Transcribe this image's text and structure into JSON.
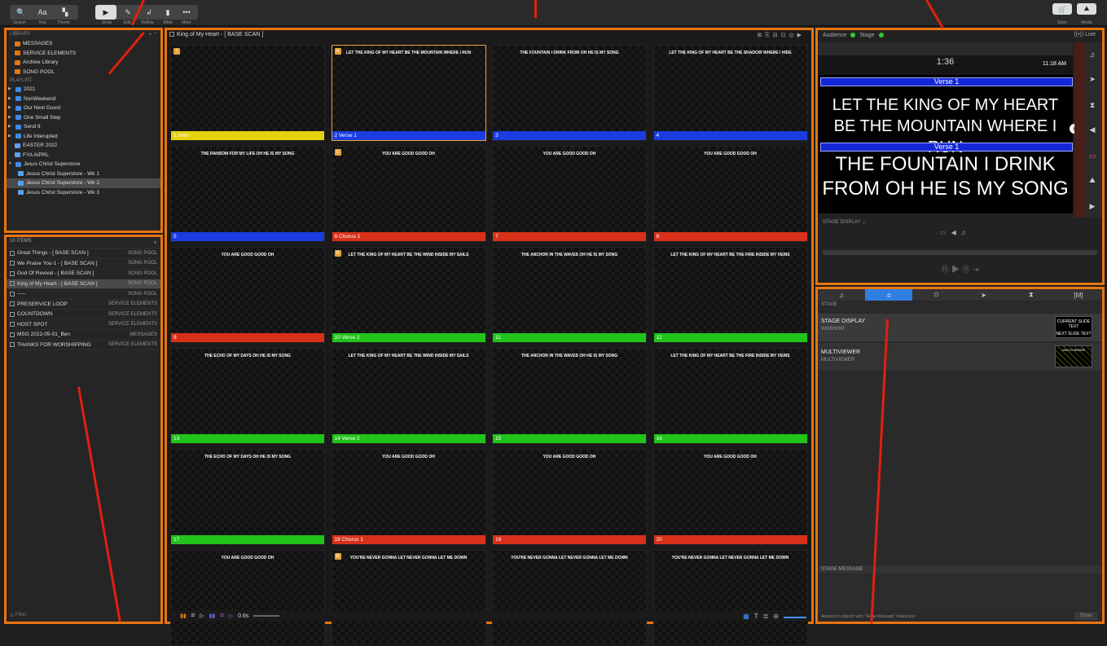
{
  "toolbar": {
    "left": [
      {
        "label": "Search",
        "icon": "search-icon"
      },
      {
        "label": "Text",
        "icon": "text-icon"
      },
      {
        "label": "Theme",
        "icon": "theme-icon"
      }
    ],
    "mode": [
      {
        "label": "Show",
        "icon": "play-icon"
      },
      {
        "label": "Edit",
        "icon": "pencil-icon"
      },
      {
        "label": "Reflow",
        "icon": "reflow-icon"
      },
      {
        "label": "Bible",
        "icon": "bible-icon"
      },
      {
        "label": "More",
        "icon": "more-icon"
      }
    ],
    "right": [
      {
        "label": "Store",
        "icon": "store-icon"
      },
      {
        "label": "Media",
        "icon": "media-icon"
      }
    ],
    "glyphs": {
      "search": "🔍",
      "text": "Aa",
      "theme": "▚",
      "show": "▶",
      "edit": "✎",
      "bible": "▮",
      "more": "•••",
      "store": "🛒",
      "media": "⛰"
    }
  },
  "library": {
    "header": "LIBRARY",
    "items": [
      "MESSAGES",
      "SERVICE ELEMENTS",
      "Archive Library",
      "SONG POOL"
    ],
    "playlist_header": "PLAYLIST",
    "playlists": [
      {
        "label": "2021",
        "type": "folder",
        "expanded": false
      },
      {
        "label": "NonWeekend",
        "type": "folder",
        "expanded": false
      },
      {
        "label": "Our Next Guest",
        "type": "folder",
        "expanded": false
      },
      {
        "label": "One Small Step",
        "type": "folder",
        "expanded": false
      },
      {
        "label": "Send It",
        "type": "folder",
        "expanded": false
      },
      {
        "label": "Life Interupted",
        "type": "folder",
        "expanded": false
      },
      {
        "label": "EASTER 2022",
        "type": "playlist"
      },
      {
        "label": "FYA AIPRL",
        "type": "playlist"
      },
      {
        "label": "Jesus Christ Superstore",
        "type": "folder",
        "expanded": true
      },
      {
        "label": "Jesus Christ Superstore - Wk 1",
        "type": "playlist",
        "child": true
      },
      {
        "label": "Jesus Christ Superstore - Wk 2",
        "type": "playlist",
        "child": true,
        "selected": true
      },
      {
        "label": "Jesus Christ Superstore - Wk 3",
        "type": "playlist",
        "child": true
      }
    ]
  },
  "playlist": {
    "count": "10 ITEMS",
    "add": "+",
    "items": [
      {
        "name": "Great Things - [ BASE SCAN ]",
        "tag": "SONG POOL"
      },
      {
        "name": "We Praise You-1 - [ BASE SCAN ]",
        "tag": "SONG POOL"
      },
      {
        "name": "God Of Revival - [ BASE SCAN ]",
        "tag": "SONG POOL"
      },
      {
        "name": "King of My Heart - [ BASE SCAN ]",
        "tag": "SONG POOL",
        "selected": true
      },
      {
        "name": "-----",
        "tag": "SONG POOL"
      },
      {
        "name": "PRESERVICE LOOP",
        "tag": "SERVICE ELEMENTS"
      },
      {
        "name": "COUNTDOWN",
        "tag": "SERVICE ELEMENTS"
      },
      {
        "name": "HOST SPOT",
        "tag": "SERVICE ELEMENTS"
      },
      {
        "name": "MSG 2022-05-01_Ben",
        "tag": "MESSAGES"
      },
      {
        "name": "THANKS FOR WORSHIPPING",
        "tag": "SERVICE ELEMENTS"
      }
    ],
    "filter_placeholder": "Filter"
  },
  "presentation": {
    "title": "King of My Heart - [ BASE SCAN ]",
    "slides": [
      {
        "num": "1",
        "label": "Intro",
        "text": "",
        "color": "#e6d20e",
        "badge": "I"
      },
      {
        "num": "2",
        "label": "Verse 1",
        "text": "LET THE KING OF MY HEART BE THE MOUNTAIN WHERE I RUN",
        "color": "#1a3ce0",
        "badge": "A",
        "selected": true
      },
      {
        "num": "3",
        "label": "",
        "text": "THE FOUNTAIN I DRINK FROM OH HE IS MY SONG",
        "color": "#1a3ce0"
      },
      {
        "num": "4",
        "label": "",
        "text": "LET THE KING OF MY HEART BE THE SHADOW WHERE I HIDE",
        "color": "#1a3ce0"
      },
      {
        "num": "5",
        "label": "",
        "text": "THE RANSOM FOR MY LIFE OH HE IS MY SONG",
        "color": "#1a3ce0"
      },
      {
        "num": "6",
        "label": "Chorus 1",
        "text": "YOU ARE GOOD GOOD OH",
        "color": "#d9301a",
        "badge": "C"
      },
      {
        "num": "7",
        "label": "",
        "text": "YOU ARE GOOD GOOD OH",
        "color": "#d9301a"
      },
      {
        "num": "8",
        "label": "",
        "text": "YOU ARE GOOD GOOD OH",
        "color": "#d9301a"
      },
      {
        "num": "9",
        "label": "",
        "text": "YOU ARE GOOD GOOD OH",
        "color": "#d9301a"
      },
      {
        "num": "10",
        "label": "Verse 2",
        "text": "LET THE KING OF MY HEART BE THE WIND INSIDE MY SAILS",
        "color": "#21c41a",
        "badge": "B"
      },
      {
        "num": "11",
        "label": "",
        "text": "THE ANCHOR IN THE WAVES OH HE IS MY SONG",
        "color": "#21c41a"
      },
      {
        "num": "12",
        "label": "",
        "text": "LET THE KING OF MY HEART BE THE FIRE INSIDE MY VEINS",
        "color": "#21c41a"
      },
      {
        "num": "13",
        "label": "",
        "text": "THE ECHO OF MY DAYS OH HE IS MY SONG",
        "color": "#21c41a"
      },
      {
        "num": "14",
        "label": "Verse 2",
        "text": "LET THE KING OF MY HEART BE THE WIND INSIDE MY SAILS",
        "color": "#21c41a"
      },
      {
        "num": "15",
        "label": "",
        "text": "THE ANCHOR IN THE WAVES OH HE IS MY SONG",
        "color": "#21c41a"
      },
      {
        "num": "16",
        "label": "",
        "text": "LET THE KING OF MY HEART BE THE FIRE INSIDE MY VEINS",
        "color": "#21c41a"
      },
      {
        "num": "17",
        "label": "",
        "text": "THE ECHO OF MY DAYS OH HE IS MY SONG",
        "color": "#21c41a"
      },
      {
        "num": "18",
        "label": "Chorus 1",
        "text": "YOU ARE GOOD GOOD OH",
        "color": "#d9301a"
      },
      {
        "num": "19",
        "label": "",
        "text": "YOU ARE GOOD GOOD OH",
        "color": "#d9301a"
      },
      {
        "num": "20",
        "label": "",
        "text": "YOU ARE GOOD GOOD OH",
        "color": "#d9301a"
      },
      {
        "num": "",
        "label": "",
        "text": "YOU ARE GOOD GOOD OH",
        "color": ""
      },
      {
        "num": "",
        "label": "",
        "text": "YOU'RE NEVER GONNA LET NEVER GONNA LET ME DOWN",
        "color": "",
        "badge": "B"
      },
      {
        "num": "",
        "label": "",
        "text": "YOU'RE NEVER GONNA LET NEVER GONNA LET ME DOWN",
        "color": ""
      },
      {
        "num": "",
        "label": "",
        "text": "YOU'RE NEVER GONNA LET NEVER GONNA LET ME DOWN",
        "color": ""
      }
    ],
    "transition": "0.6s"
  },
  "preview": {
    "audience": "Audience",
    "stage": "Stage",
    "live": "Live",
    "timer": "1:36",
    "clock": "11:18 AM",
    "verse_label": "Verse 1",
    "current_text": "LET THE KING OF MY HEART BE THE MOUNTAIN WHERE I RUN",
    "next_label": "Verse 1",
    "next_text": "THE FOUNTAIN I DRINK FROM OH HE IS MY SONG",
    "stage_display": "STAGE DISPLAY ⌄",
    "transport": "⑮  ▶  ⑮  ⇥"
  },
  "stage_panel": {
    "tabs": [
      "♫",
      "≑",
      "⏲",
      "➤",
      "⧗",
      "[M]"
    ],
    "section": "STAGE",
    "layouts": [
      {
        "title": "STAGE DISPLAY",
        "sub": "WORSHIP",
        "thumb1": "CURRENT SLIDE TEXT",
        "thumb2": "NEXT SLIDE TEXT"
      },
      {
        "title": "MULTIVIEWER",
        "sub": "MULTIVIEWER",
        "thumb1": "MULTIVIEWER",
        "thumb2": ""
      }
    ],
    "message_header": "STAGE MESSAGE",
    "message_hint": "Appears in objects with \"Stage Message\" linked text",
    "show_button": "Show"
  },
  "colors": {
    "accent": "#e8750f",
    "selection": "#2f7fe0",
    "arrow": "#e02010"
  }
}
